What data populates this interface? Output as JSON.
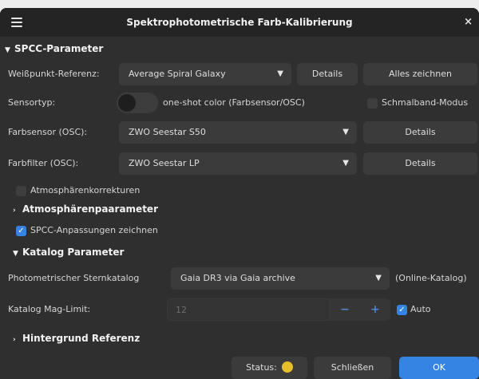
{
  "window": {
    "title": "Spektrophotometrische Farb-Kalibrierung",
    "close_glyph": "×",
    "menu_icon": "hamburger-menu-icon"
  },
  "spcc_section": {
    "header": "SPCC-Parameter",
    "white_ref": {
      "label": "Weißpunkt-Referenz:",
      "value": "Average Spiral Galaxy",
      "details_button": "Details",
      "plot_all_button": "Alles zeichnen"
    },
    "sensor_type": {
      "label": "Sensortyp:",
      "toggle_on": false,
      "value": "one-shot color (Farbsensor/OSC)",
      "narrowband_label": "Schmalband-Modus",
      "narrowband_checked": false
    },
    "color_sensor": {
      "label": "Farbsensor (OSC):",
      "value": "ZWO Seestar S50",
      "details_button": "Details"
    },
    "color_filter": {
      "label": "Farbfilter (OSC):",
      "value": "ZWO Seestar LP",
      "details_button": "Details"
    },
    "atmos_corrections": {
      "label": "Atmosphärenkorrekturen",
      "checked": false
    }
  },
  "atmos_section": {
    "header": "Atmosphärenpaarameter"
  },
  "plot_adjustments": {
    "label": "SPCC-Anpassungen zeichnen",
    "checked": true
  },
  "catalog_section": {
    "header": "Katalog Parameter",
    "photometric_catalog": {
      "label": "Photometrischer Sternkatalog",
      "value": "Gaia DR3 via Gaia archive",
      "note": "(Online-Katalog)"
    },
    "mag_limit": {
      "label": "Katalog Mag-Limit:",
      "value": "12",
      "minus": "−",
      "plus": "+",
      "auto_label": "Auto",
      "auto_checked": true
    }
  },
  "background_section": {
    "header": "Hintergrund Referenz"
  },
  "footer": {
    "status_label": "Status:",
    "status_color": "#e5c02c",
    "close_button": "Schließen",
    "ok_button": "OK"
  },
  "chevrons": {
    "expanded": "⌄",
    "collapsed": "›"
  }
}
